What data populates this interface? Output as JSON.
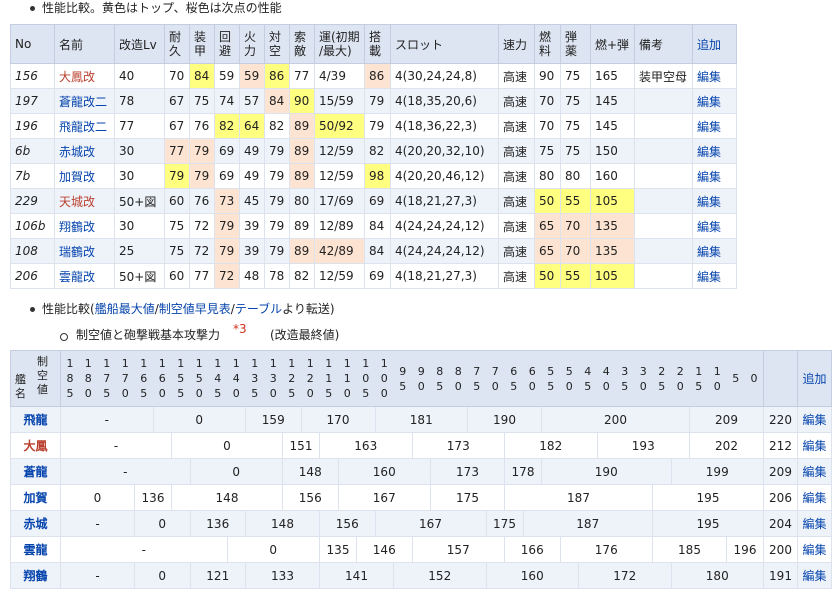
{
  "section1": {
    "title": "性能比較。黄色はトップ、桜色は次点の性能"
  },
  "table1": {
    "headers": {
      "no": "No",
      "name": "名前",
      "kaizo": "改造Lv",
      "hp": [
        "耐",
        "久"
      ],
      "armor": [
        "装",
        "甲"
      ],
      "evasion": [
        "回",
        "避"
      ],
      "firepower": [
        "火",
        "力"
      ],
      "aa": [
        "対",
        "空"
      ],
      "los": [
        "索",
        "敵"
      ],
      "luck": [
        "運(初期",
        "/最大)"
      ],
      "capacity": [
        "搭",
        "載"
      ],
      "slot": "スロット",
      "speed": "速力",
      "fuel": [
        "燃",
        "料"
      ],
      "ammo": [
        "弾",
        "薬"
      ],
      "fuel_ammo": "燃+弾",
      "remarks": "備考",
      "add": "追加"
    },
    "rows": [
      {
        "no": "156",
        "name": "大鳳改",
        "name_color": "#ba3f2e",
        "kaizo": "40",
        "hp": "70",
        "armor": "84",
        "evasion": "59",
        "firepower": "59",
        "aa": "86",
        "los": "77",
        "luck": "4/39",
        "capacity": "86",
        "slot": "4(30,24,24,8)",
        "speed": "高速",
        "fuel": "90",
        "ammo": "75",
        "fuel_ammo": "165",
        "remarks": "装甲空母",
        "edit": "編集"
      },
      {
        "no": "197",
        "name": "蒼龍改二",
        "name_color": "#0645ad",
        "kaizo": "78",
        "hp": "67",
        "armor": "75",
        "evasion": "74",
        "firepower": "57",
        "aa": "84",
        "los": "90",
        "luck": "15/59",
        "capacity": "79",
        "slot": "4(18,35,20,6)",
        "speed": "高速",
        "fuel": "70",
        "ammo": "75",
        "fuel_ammo": "145",
        "remarks": "",
        "edit": "編集"
      },
      {
        "no": "196",
        "name": "飛龍改二",
        "name_color": "#0645ad",
        "kaizo": "77",
        "hp": "67",
        "armor": "76",
        "evasion": "82",
        "firepower": "64",
        "aa": "82",
        "los": "89",
        "luck": "50/92",
        "capacity": "79",
        "slot": "4(18,36,22,3)",
        "speed": "高速",
        "fuel": "70",
        "ammo": "75",
        "fuel_ammo": "145",
        "remarks": "",
        "edit": "編集"
      },
      {
        "no": "6b",
        "name": "赤城改",
        "name_color": "#0645ad",
        "kaizo": "30",
        "hp": "77",
        "armor": "79",
        "evasion": "69",
        "firepower": "49",
        "aa": "79",
        "los": "89",
        "luck": "12/59",
        "capacity": "82",
        "slot": "4(20,20,32,10)",
        "speed": "高速",
        "fuel": "75",
        "ammo": "75",
        "fuel_ammo": "150",
        "remarks": "",
        "edit": "編集"
      },
      {
        "no": "7b",
        "name": "加賀改",
        "name_color": "#0645ad",
        "kaizo": "30",
        "hp": "79",
        "armor": "79",
        "evasion": "69",
        "firepower": "49",
        "aa": "79",
        "los": "89",
        "luck": "12/59",
        "capacity": "98",
        "slot": "4(20,20,46,12)",
        "speed": "高速",
        "fuel": "80",
        "ammo": "80",
        "fuel_ammo": "160",
        "remarks": "",
        "edit": "編集"
      },
      {
        "no": "229",
        "name": "天城改",
        "name_color": "#ba3f2e",
        "kaizo": "50+図",
        "hp": "60",
        "armor": "76",
        "evasion": "73",
        "firepower": "45",
        "aa": "79",
        "los": "80",
        "luck": "17/69",
        "capacity": "69",
        "slot": "4(18,21,27,3)",
        "speed": "高速",
        "fuel": "50",
        "ammo": "55",
        "fuel_ammo": "105",
        "remarks": "",
        "edit": "編集"
      },
      {
        "no": "106b",
        "name": "翔鶴改",
        "name_color": "#0645ad",
        "kaizo": "30",
        "hp": "75",
        "armor": "72",
        "evasion": "79",
        "firepower": "39",
        "aa": "79",
        "los": "89",
        "luck": "12/89",
        "capacity": "84",
        "slot": "4(24,24,24,12)",
        "speed": "高速",
        "fuel": "65",
        "ammo": "70",
        "fuel_ammo": "135",
        "remarks": "",
        "edit": "編集"
      },
      {
        "no": "108",
        "name": "瑞鶴改",
        "name_color": "#0645ad",
        "kaizo": "25",
        "hp": "75",
        "armor": "72",
        "evasion": "79",
        "firepower": "39",
        "aa": "79",
        "los": "89",
        "luck": "42/89",
        "capacity": "84",
        "slot": "4(24,24,24,12)",
        "speed": "高速",
        "fuel": "65",
        "ammo": "70",
        "fuel_ammo": "135",
        "remarks": "",
        "edit": "編集"
      },
      {
        "no": "206",
        "name": "雲龍改",
        "name_color": "#0645ad",
        "kaizo": "50+図",
        "hp": "60",
        "armor": "77",
        "evasion": "72",
        "firepower": "48",
        "aa": "78",
        "los": "82",
        "luck": "12/59",
        "capacity": "69",
        "slot": "4(18,21,27,3)",
        "speed": "高速",
        "fuel": "50",
        "ammo": "55",
        "fuel_ammo": "105",
        "remarks": "",
        "edit": "編集"
      }
    ],
    "highlights": {
      "yellow": [
        [
          0,
          "armor"
        ],
        [
          0,
          "aa"
        ],
        [
          1,
          "los"
        ],
        [
          2,
          "evasion"
        ],
        [
          2,
          "firepower"
        ],
        [
          2,
          "luck"
        ],
        [
          4,
          "hp"
        ],
        [
          4,
          "capacity"
        ],
        [
          5,
          "fuel"
        ],
        [
          5,
          "ammo"
        ],
        [
          5,
          "fuel_ammo"
        ],
        [
          8,
          "fuel"
        ],
        [
          8,
          "ammo"
        ],
        [
          8,
          "fuel_ammo"
        ]
      ],
      "pink": [
        [
          0,
          "firepower"
        ],
        [
          0,
          "capacity"
        ],
        [
          1,
          "aa"
        ],
        [
          2,
          "los"
        ],
        [
          3,
          "hp"
        ],
        [
          3,
          "armor"
        ],
        [
          3,
          "los"
        ],
        [
          4,
          "armor"
        ],
        [
          4,
          "los"
        ],
        [
          5,
          "evasion"
        ],
        [
          6,
          "evasion"
        ],
        [
          6,
          "fuel"
        ],
        [
          6,
          "ammo"
        ],
        [
          6,
          "fuel_ammo"
        ],
        [
          7,
          "evasion"
        ],
        [
          7,
          "los"
        ],
        [
          7,
          "luck"
        ],
        [
          7,
          "fuel"
        ],
        [
          7,
          "ammo"
        ],
        [
          7,
          "fuel_ammo"
        ],
        [
          8,
          "evasion"
        ]
      ]
    }
  },
  "section2": {
    "prefix": "性能比較(",
    "link1": "艦船最大値",
    "sep1": "/",
    "link2": "制空値早見表",
    "sep2": "/",
    "link3": "テーブル",
    "suffix": "より転送)",
    "sub_label": "制空値と砲撃戦基本攻撃力",
    "footnote": "*3",
    "sub_note": "(改造最終値)"
  },
  "table2": {
    "corner_top": [
      "制",
      "空",
      "値"
    ],
    "corner_left": [
      "艦",
      "名"
    ],
    "columns": [
      [
        "1",
        "8",
        "5"
      ],
      [
        "1",
        "8",
        "0"
      ],
      [
        "1",
        "7",
        "5"
      ],
      [
        "1",
        "7",
        "0"
      ],
      [
        "1",
        "6",
        "5"
      ],
      [
        "1",
        "6",
        "0"
      ],
      [
        "1",
        "5",
        "5"
      ],
      [
        "1",
        "5",
        "0"
      ],
      [
        "1",
        "4",
        "5"
      ],
      [
        "1",
        "4",
        "0"
      ],
      [
        "1",
        "3",
        "5"
      ],
      [
        "1",
        "3",
        "0"
      ],
      [
        "1",
        "2",
        "5"
      ],
      [
        "1",
        "2",
        "0"
      ],
      [
        "1",
        "1",
        "5"
      ],
      [
        "1",
        "1",
        "0"
      ],
      [
        "1",
        "0",
        "5"
      ],
      [
        "1",
        "0",
        "0"
      ],
      [
        "9",
        "5"
      ],
      [
        "9",
        "0"
      ],
      [
        "8",
        "5"
      ],
      [
        "8",
        "0"
      ],
      [
        "7",
        "5"
      ],
      [
        "7",
        "0"
      ],
      [
        "6",
        "5"
      ],
      [
        "6",
        "0"
      ],
      [
        "5",
        "5"
      ],
      [
        "5",
        "0"
      ],
      [
        "4",
        "5"
      ],
      [
        "4",
        "0"
      ],
      [
        "3",
        "5"
      ],
      [
        "3",
        "0"
      ],
      [
        "2",
        "5"
      ],
      [
        "2",
        "0"
      ],
      [
        "1",
        "5"
      ],
      [
        "1",
        "0"
      ],
      [
        "5"
      ],
      [
        "0"
      ]
    ],
    "add": "追加",
    "rows": [
      {
        "ship": "飛龍",
        "color": "#0645ad",
        "cells": [
          {
            "t": "-",
            "span": 5
          },
          {
            "t": "0",
            "span": 5
          },
          {
            "t": "159",
            "span": 3
          },
          {
            "t": "170",
            "span": 4
          },
          {
            "t": "181",
            "span": 5
          },
          {
            "t": "190",
            "span": 4
          },
          {
            "t": "200",
            "span": 8
          },
          {
            "t": "209",
            "span": 4
          }
        ],
        "total": "220",
        "edit": "編集"
      },
      {
        "ship": "大鳳",
        "color": "#ba3f2e",
        "cells": [
          {
            "t": "-",
            "span": 6
          },
          {
            "t": "0",
            "span": 6
          },
          {
            "t": "151",
            "span": 2
          },
          {
            "t": "163",
            "span": 5
          },
          {
            "t": "173",
            "span": 5
          },
          {
            "t": "182",
            "span": 5
          },
          {
            "t": "193",
            "span": 5
          },
          {
            "t": "202",
            "span": 4
          }
        ],
        "total": "212",
        "edit": "編集"
      },
      {
        "ship": "蒼龍",
        "color": "#0645ad",
        "cells": [
          {
            "t": "-",
            "span": 7
          },
          {
            "t": "0",
            "span": 5
          },
          {
            "t": "148",
            "span": 3
          },
          {
            "t": "160",
            "span": 5
          },
          {
            "t": "173",
            "span": 4
          },
          {
            "t": "178",
            "span": 2
          },
          {
            "t": "190",
            "span": 7
          },
          {
            "t": "199",
            "span": 5
          }
        ],
        "total": "209",
        "edit": "編集"
      },
      {
        "ship": "加賀",
        "color": "#0645ad",
        "cells": [
          {
            "t": "0",
            "span": 4
          },
          {
            "t": "136",
            "span": 2
          },
          {
            "t": "148",
            "span": 6
          },
          {
            "t": "156",
            "span": 3
          },
          {
            "t": "167",
            "span": 5
          },
          {
            "t": "175",
            "span": 4
          },
          {
            "t": "187",
            "span": 8
          },
          {
            "t": "195",
            "span": 6
          }
        ],
        "total": "206",
        "edit": "編集"
      },
      {
        "ship": "赤城",
        "color": "#0645ad",
        "cells": [
          {
            "t": "-",
            "span": 4
          },
          {
            "t": "0",
            "span": 3
          },
          {
            "t": "136",
            "span": 3
          },
          {
            "t": "148",
            "span": 4
          },
          {
            "t": "156",
            "span": 3
          },
          {
            "t": "167",
            "span": 6
          },
          {
            "t": "175",
            "span": 2
          },
          {
            "t": "187",
            "span": 7
          },
          {
            "t": "195",
            "span": 6
          }
        ],
        "total": "204",
        "edit": "編集"
      },
      {
        "ship": "雲龍",
        "color": "#0645ad",
        "cells": [
          {
            "t": "-",
            "span": 9
          },
          {
            "t": "0",
            "span": 5
          },
          {
            "t": "135",
            "span": 2
          },
          {
            "t": "146",
            "span": 3
          },
          {
            "t": "157",
            "span": 5
          },
          {
            "t": "166",
            "span": 3
          },
          {
            "t": "176",
            "span": 5
          },
          {
            "t": "185",
            "span": 4
          },
          {
            "t": "196",
            "span": 2
          }
        ],
        "total": "200",
        "edit": "編集"
      },
      {
        "ship": "翔鶴",
        "color": "#0645ad",
        "cells": [
          {
            "t": "-",
            "span": 4
          },
          {
            "t": "0",
            "span": 3
          },
          {
            "t": "121",
            "span": 3
          },
          {
            "t": "133",
            "span": 4
          },
          {
            "t": "141",
            "span": 4
          },
          {
            "t": "152",
            "span": 5
          },
          {
            "t": "160",
            "span": 5
          },
          {
            "t": "172",
            "span": 5
          },
          {
            "t": "180",
            "span": 5
          }
        ],
        "total": "191",
        "edit": "編集"
      }
    ]
  }
}
